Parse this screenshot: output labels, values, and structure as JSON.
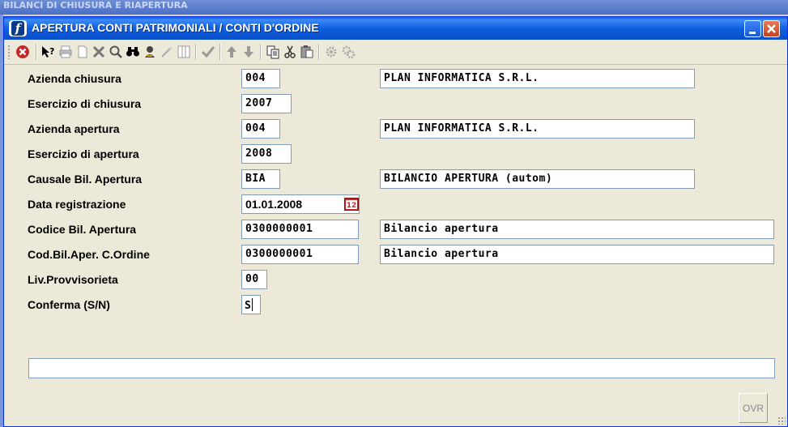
{
  "background_window": {
    "title": "BILANCI DI CHIUSURA E RIAPERTURA"
  },
  "window": {
    "title": "APERTURA CONTI PATRIMONIALI / CONTI D'ORDINE",
    "app_icon_letter": "f"
  },
  "toolbar": {
    "icons": [
      "close-red-icon",
      "help-icon",
      "print-icon",
      "new-page-icon",
      "delete-icon",
      "search-icon",
      "binoculars-icon",
      "user-icon",
      "wand-icon",
      "columns-icon",
      "checkmark-icon",
      "arrow-up-icon",
      "arrow-down-icon",
      "copy-icon",
      "cut-icon",
      "paste-icon",
      "gear-icon",
      "gears-icon"
    ]
  },
  "form": {
    "azienda_chiusura": {
      "label": "Azienda chiusura",
      "code": "004",
      "desc": "PLAN INFORMATICA S.R.L."
    },
    "esercizio_chiusura": {
      "label": "Esercizio di chiusura",
      "value": "2007"
    },
    "azienda_apertura": {
      "label": "Azienda apertura",
      "code": "004",
      "desc": "PLAN INFORMATICA S.R.L."
    },
    "esercizio_apertura": {
      "label": "Esercizio di apertura",
      "value": "2008"
    },
    "causale": {
      "label": "Causale Bil. Apertura",
      "code": "BIA",
      "desc": "BILANCIO APERTURA (autom)"
    },
    "data_registrazione": {
      "label": "Data registrazione",
      "value": "01.01.2008",
      "calendar_icon_text": "12"
    },
    "codice_bil": {
      "label": "Codice Bil. Apertura",
      "code": "0300000001",
      "desc": "Bilancio apertura"
    },
    "cod_bil_ordine": {
      "label": "Cod.Bil.Aper. C.Ordine",
      "code": "0300000001",
      "desc": "Bilancio apertura"
    },
    "liv_provvisorieta": {
      "label": "Liv.Provvisorieta",
      "value": "00"
    },
    "conferma": {
      "label": "Conferma (S/N)",
      "value": "S"
    }
  },
  "status": {
    "mode": "OVR"
  }
}
